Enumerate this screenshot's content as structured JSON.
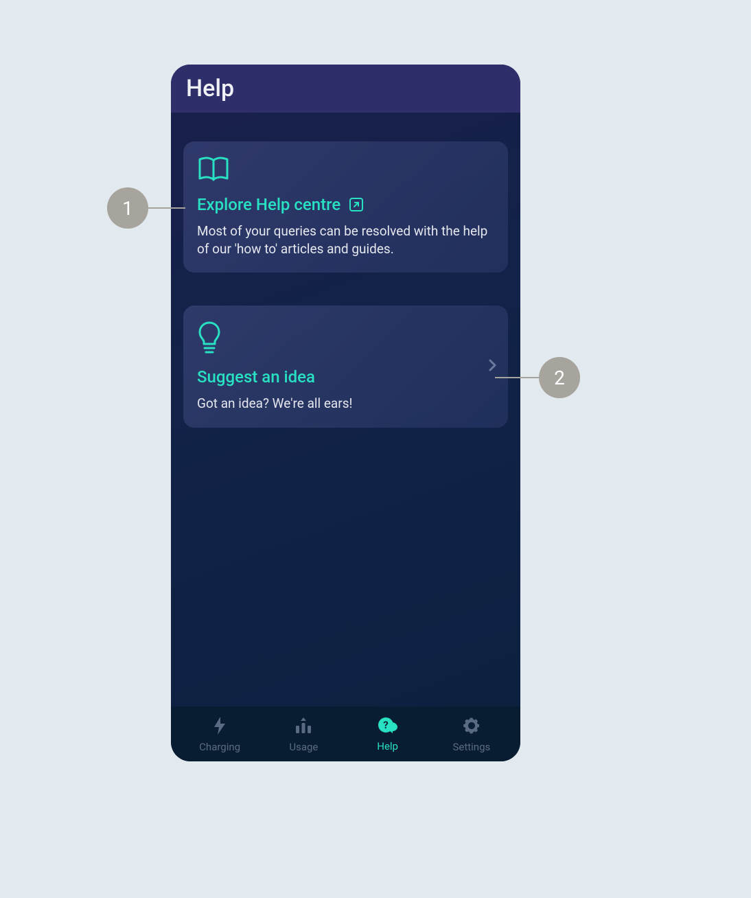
{
  "header": {
    "title": "Help"
  },
  "cards": [
    {
      "title": "Explore Help centre",
      "description": "Most of your queries can be resolved with the help of our 'how to' articles and guides."
    },
    {
      "title": "Suggest an idea",
      "description": "Got an idea? We're all ears!"
    }
  ],
  "tabs": [
    {
      "label": "Charging"
    },
    {
      "label": "Usage"
    },
    {
      "label": "Help"
    },
    {
      "label": "Settings"
    }
  ],
  "callouts": {
    "one": "1",
    "two": "2"
  },
  "colors": {
    "accent": "#28e0c2"
  }
}
